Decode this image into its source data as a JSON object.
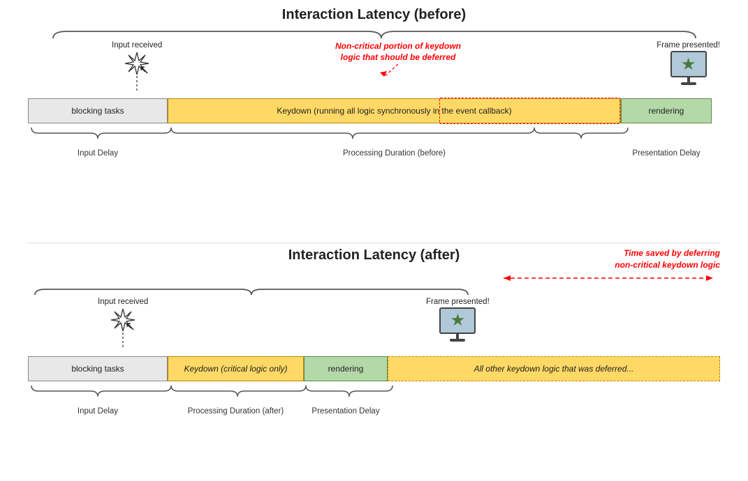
{
  "top": {
    "title": "Interaction Latency (before)",
    "input_received": "Input received",
    "frame_presented": "Frame presented!",
    "blocking_label": "blocking tasks",
    "keydown_label": "Keydown (running all logic synchronously in the event callback)",
    "rendering_label": "rendering",
    "deferred_note_line1": "Non-critical portion of keydown",
    "deferred_note_line2": "logic that should be deferred",
    "input_delay_label": "Input Delay",
    "processing_label": "Processing Duration (before)",
    "presentation_label": "Presentation Delay"
  },
  "bottom": {
    "title": "Interaction Latency (after)",
    "time_saved_line1": "Time saved by deferring",
    "time_saved_line2": "non-critical keydown logic",
    "input_received": "Input received",
    "frame_presented": "Frame presented!",
    "blocking_label": "blocking tasks",
    "keydown_label": "Keydown (critical logic only)",
    "rendering_label": "rendering",
    "deferred_label": "All other keydown logic that was deferred...",
    "input_delay_label": "Input Delay",
    "processing_label": "Processing Duration (after)",
    "presentation_label": "Presentation Delay"
  },
  "icons": {
    "star": "★",
    "cursor": "↖",
    "starburst": "✳"
  }
}
